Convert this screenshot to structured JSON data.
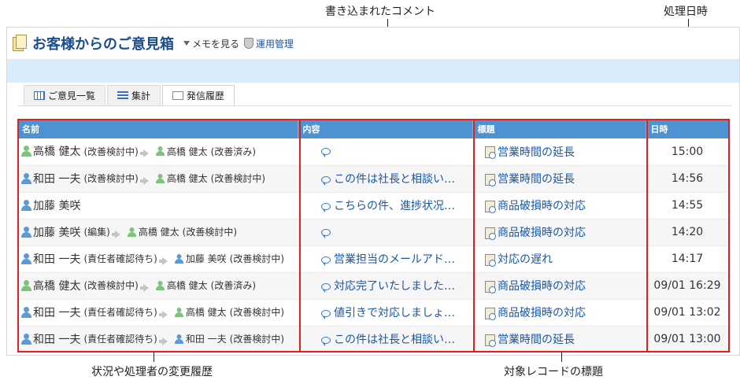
{
  "callouts": {
    "comment": "書き込まれたコメント",
    "datetime": "処理日時",
    "status_history": "状況や処理者の変更履歴",
    "record_title": "対象レコードの標題"
  },
  "app": {
    "title": "お客様からのご意見箱",
    "memo_label": "メモを見る",
    "admin_label": "運用管理"
  },
  "tabs": [
    {
      "label": "ご意見一覧"
    },
    {
      "label": "集計"
    },
    {
      "label": "発信履歴"
    }
  ],
  "table": {
    "headers": [
      "名前",
      "内容",
      "標題",
      "日時"
    ],
    "rows": [
      {
        "from": "高橋 健太",
        "from_status": "(改善検討中)",
        "to": "高橋 健太",
        "to_status": "(改善済み)",
        "content": "",
        "title": "営業時間の延長",
        "time": "15:00"
      },
      {
        "from": "和田 一夫",
        "from_status": "(改善検討中)",
        "to": "高橋 健太",
        "to_status": "(改善検討中)",
        "content": "この件は社長と相談い…",
        "title": "営業時間の延長",
        "time": "14:56"
      },
      {
        "from": "加藤 美咲",
        "from_status": "",
        "to": "",
        "to_status": "",
        "content": "こちらの件、進捗状况…",
        "title": "商品破損時の対応",
        "time": "14:55"
      },
      {
        "from": "加藤 美咲",
        "from_status": "(編集)",
        "to": "高橋 健太",
        "to_status": "(改善検討中)",
        "content": "",
        "title": "商品破損時の対応",
        "time": "14:20"
      },
      {
        "from": "和田 一夫",
        "from_status": "(責任者確認待ち)",
        "to": "加藤 美咲",
        "to_status": "(改善検討中)",
        "content": "営業担当のメールアド…",
        "title": "対応の遅れ",
        "time": "14:17"
      },
      {
        "from": "高橋 健太",
        "from_status": "(改善検討中)",
        "to": "高橋 健太",
        "to_status": "(改善済み)",
        "content": "対応完了いたしました…",
        "title": "商品破損時の対応",
        "time": "09/01 16:29"
      },
      {
        "from": "和田 一夫",
        "from_status": "(責任者確認待ち)",
        "to": "高橋 健太",
        "to_status": "(改善検討中)",
        "content": "値引きで対応しましょ…",
        "title": "商品破損時の対応",
        "time": "09/01 13:02"
      },
      {
        "from": "和田 一夫",
        "from_status": "(責任者確認待ち)",
        "to": "和田 一夫",
        "to_status": "(改善検討中)",
        "content": "この件は社長と相談い…",
        "title": "営業時間の延長",
        "time": "09/01 13:00"
      }
    ]
  }
}
